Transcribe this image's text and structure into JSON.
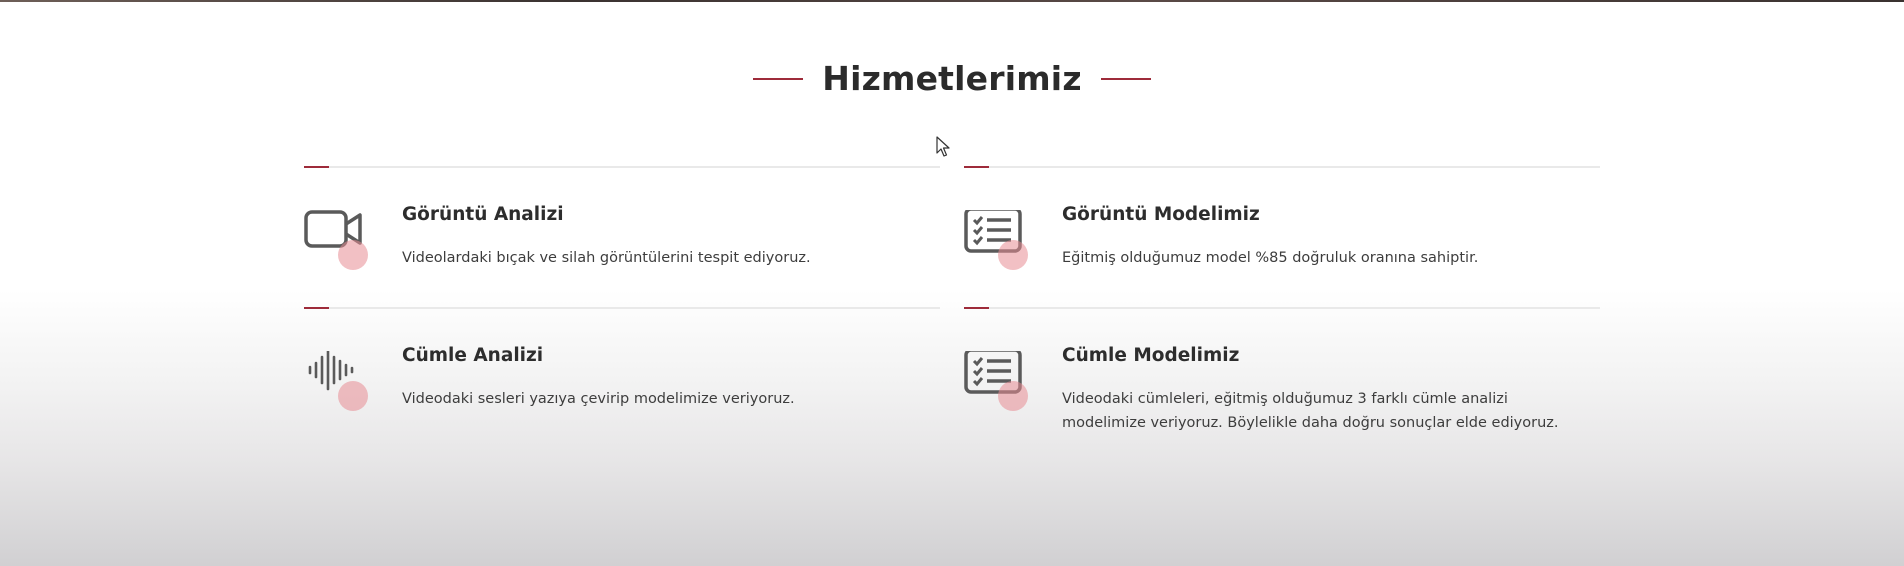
{
  "section": {
    "title": "Hizmetlerimiz"
  },
  "colors": {
    "accent": "#9e2b3a",
    "icon_dot": "#e88c94",
    "icon_stroke": "#5a5a5a",
    "divider": "#e9e9e9"
  },
  "services": [
    {
      "icon": "video-camera-icon",
      "title": "Görüntü Analizi",
      "description": "Videolardaki bıçak ve silah görüntülerini tespit ediyoruz."
    },
    {
      "icon": "checklist-icon",
      "title": "Görüntü Modelimiz",
      "description": "Eğitmiş olduğumuz model %85 doğruluk oranına sahiptir."
    },
    {
      "icon": "sound-wave-icon",
      "title": "Cümle Analizi",
      "description": "Videodaki sesleri yazıya çevirip modelimize veriyoruz."
    },
    {
      "icon": "checklist-icon",
      "title": "Cümle Modelimiz",
      "description": "Videodaki cümleleri, eğitmiş olduğumuz 3 farklı cümle analizi modelimize veriyoruz. Böylelikle daha doğru sonuçlar elde ediyoruz."
    }
  ]
}
